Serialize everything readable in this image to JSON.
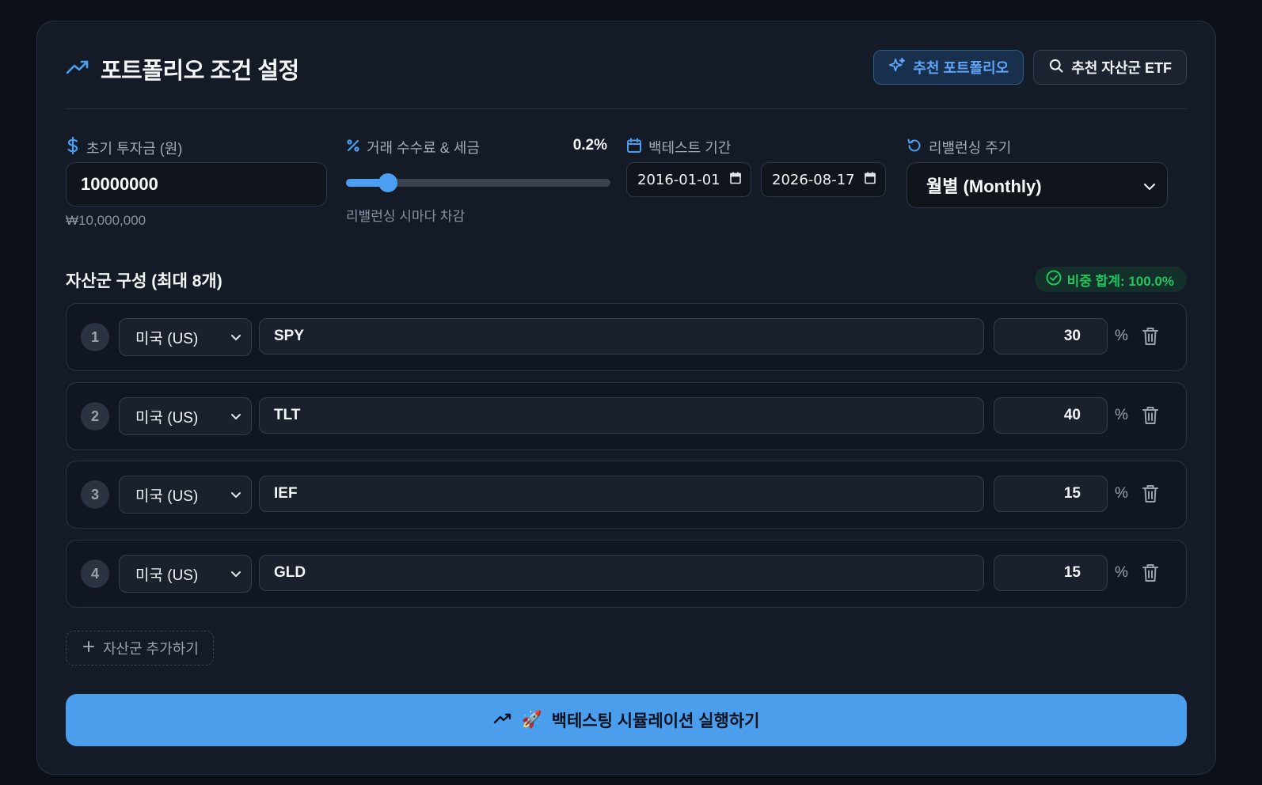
{
  "header": {
    "title": "포트폴리오 조건 설정",
    "recommend_portfolio_label": "추천 포트폴리오",
    "recommend_etf_label": "추천 자산군 ETF"
  },
  "initial_investment": {
    "label": "초기 투자금 (원)",
    "value": "10000000",
    "formatted": "₩10,000,000"
  },
  "fee": {
    "label": "거래 수수료 & 세금",
    "value_text": "0.2%",
    "note": "리밸런싱 시마다 차감",
    "slider_fraction": 0.16
  },
  "backtest_period": {
    "label": "백테스트 기간",
    "start_date": "2016-01-01",
    "end_date": "2026-08-17"
  },
  "rebalancing": {
    "label": "리밸런싱 주기",
    "selected": "월별 (Monthly)"
  },
  "assets": {
    "title": "자산군 구성 (최대 8개)",
    "sum_label": "비중 합계: 100.0%",
    "percent_symbol": "%",
    "rows": [
      {
        "index": "1",
        "market": "미국 (US)",
        "ticker": "SPY",
        "weight": "30"
      },
      {
        "index": "2",
        "market": "미국 (US)",
        "ticker": "TLT",
        "weight": "40"
      },
      {
        "index": "3",
        "market": "미국 (US)",
        "ticker": "IEF",
        "weight": "15"
      },
      {
        "index": "4",
        "market": "미국 (US)",
        "ticker": "GLD",
        "weight": "15"
      }
    ],
    "add_label": "자산군 추가하기"
  },
  "run_button": {
    "emoji": "🚀",
    "label": "백테스팅 시뮬레이션 실행하기"
  },
  "colors": {
    "accent": "#4a9eec",
    "success": "#22c55e",
    "card_bg": "#151b26",
    "page_bg": "#0b1019"
  },
  "icons": {
    "title": "trending-up-icon",
    "recommend_portfolio": "sparkles-icon",
    "recommend_etf": "search-icon",
    "investment": "dollar-icon",
    "fee": "percent-icon",
    "period": "calendar-icon",
    "rebalancing": "rotate-icon",
    "sum": "check-circle-icon",
    "delete": "trash-icon",
    "add": "plus-icon",
    "run": "trending-up-icon"
  }
}
